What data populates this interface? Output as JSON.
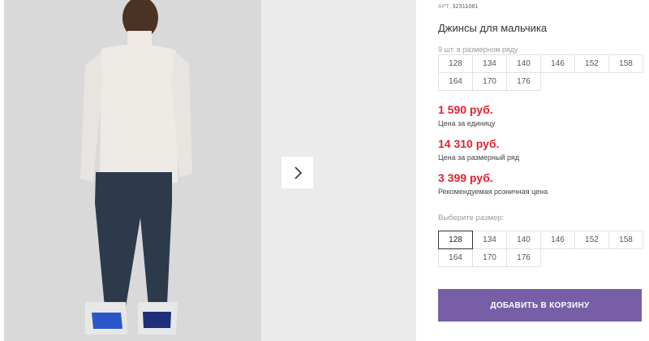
{
  "product": {
    "sku_label": "АРТ.",
    "sku": "32311081",
    "title": "Джинсы для мальчика",
    "pack_note": "9 шт. в размерном ряду",
    "pack_sizes": [
      "128",
      "134",
      "140",
      "146",
      "152",
      "158",
      "164",
      "170",
      "176"
    ]
  },
  "prices": [
    {
      "value": "1 590 руб.",
      "label": "Цена за единицу"
    },
    {
      "value": "14 310 руб.",
      "label": "Цена за размерный ряд"
    },
    {
      "value": "3 399 руб.",
      "label": "Рекомендуемая розничная цена"
    }
  ],
  "size_picker": {
    "label": "Выберите размер:",
    "selected": "128",
    "options": [
      "128",
      "134",
      "140",
      "146",
      "152",
      "158",
      "164",
      "170",
      "176"
    ]
  },
  "cart_button": "ДОБАВИТЬ В КОРЗИНУ",
  "colors": {
    "price": "#e2222f",
    "accent": "#775ea7"
  },
  "icons": {
    "next": "chevron-right-icon"
  }
}
